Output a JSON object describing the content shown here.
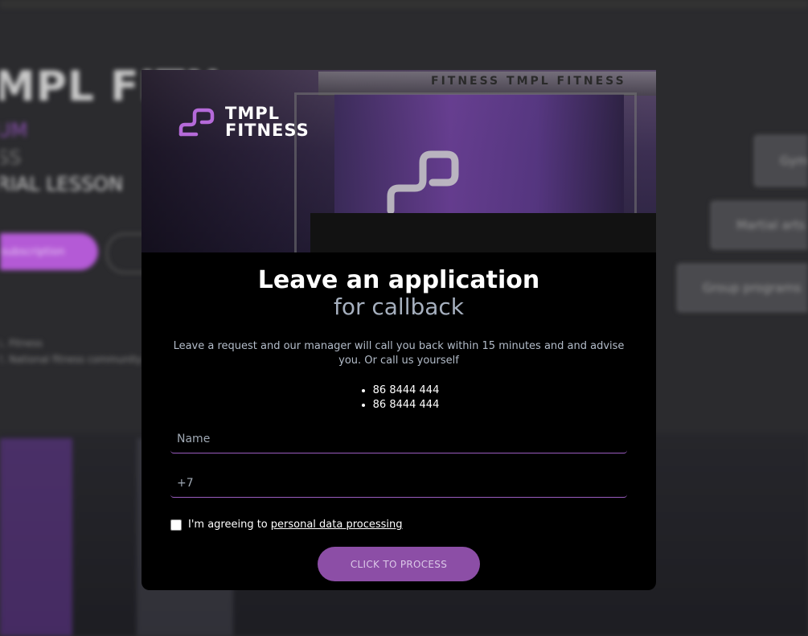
{
  "background": {
    "hero_title": "MPL FITN",
    "hero_lines": [
      "UM",
      "SS",
      "RIAL LESSON"
    ],
    "hero_button": "subscription",
    "notes": [
      "1. Fitness",
      "2. National fitness community"
    ],
    "side_pills": [
      "Gym",
      "Martial arts",
      "Group programs"
    ],
    "ceiling_text": "FITNESS   TMPL FITNESS"
  },
  "modal": {
    "logo": {
      "line1": "TMPL",
      "line2": "FITNESS",
      "icon": "tmpl-logo-icon"
    },
    "title": "Leave an application",
    "subtitle": "for callback",
    "description": "Leave a request and our manager will call you back within 15 minutes and and advise you. Or call us yourself",
    "phones": [
      "86 8444 444",
      "86 8444 444"
    ],
    "name_field": {
      "placeholder": "Name",
      "value": ""
    },
    "phone_field": {
      "placeholder": "+7",
      "value": ""
    },
    "agree_text": "I'm agreeing to",
    "agree_link": "personal data processing",
    "submit_label": "CLICK TO PROCESS"
  },
  "colors": {
    "accent": "#8c4ea6",
    "field_underline": "#9a5cc0",
    "modal_bg": "#000000",
    "subtitle": "#a6b0bf"
  }
}
